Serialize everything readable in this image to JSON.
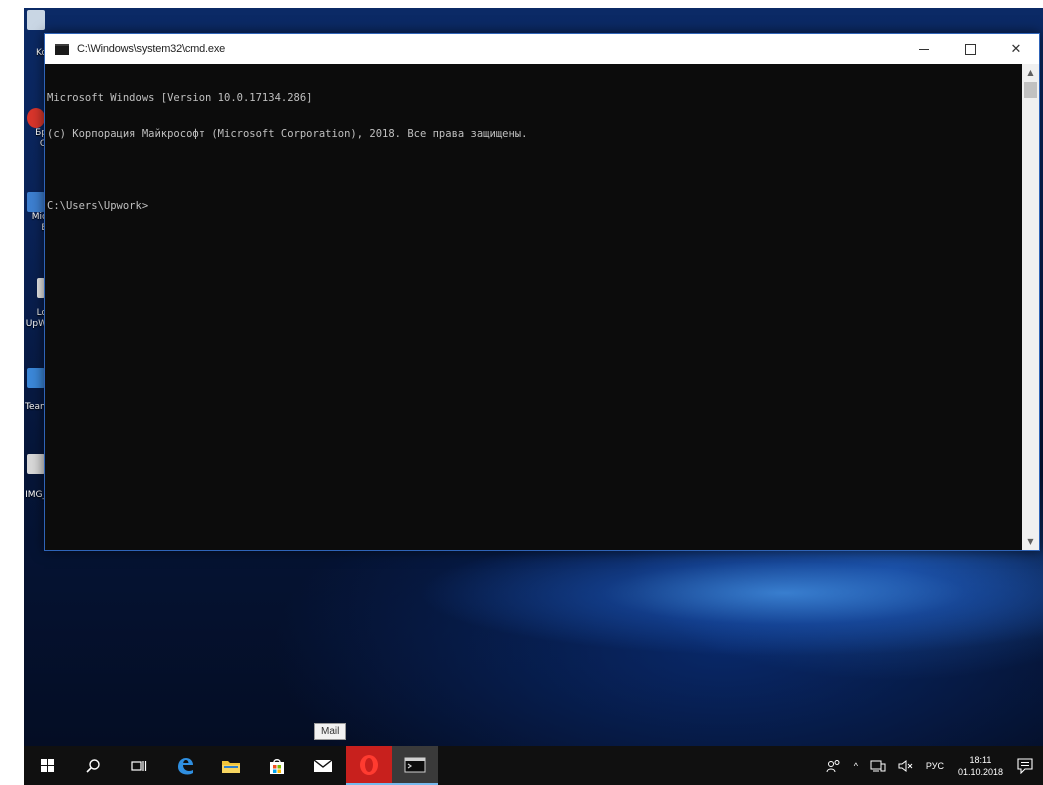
{
  "window": {
    "title": "C:\\Windows\\system32\\cmd.exe",
    "console_lines": [
      "Microsoft Windows [Version 10.0.17134.286]",
      "(c) Корпорация Майкрософт (Microsoft Corporation), 2018. Все права защищены.",
      "",
      "C:\\Users\\Upwork>"
    ]
  },
  "desktop_icons": [
    {
      "label": "Ko",
      "icon": "recycle-bin-icon",
      "color": "#c9d6e4"
    },
    {
      "label": "Бр",
      "label2": "O",
      "icon": "opera-icon",
      "color": "#d8352b"
    },
    {
      "label": "Mic",
      "label2": "E",
      "icon": "document-icon",
      "color": "#3d7fd0"
    },
    {
      "label": "Lo",
      "label2": "UpW",
      "icon": "shortcut-icon",
      "color": "#e8e8e8"
    },
    {
      "label": "Team",
      "icon": "teamviewer-icon",
      "color": "#3b87d8"
    },
    {
      "label": "IMG_",
      "icon": "image-file-icon",
      "color": "#d8d8d8"
    }
  ],
  "tooltip": "Mail",
  "taskbar": {
    "items": [
      {
        "name": "start-button",
        "icon": "windows-icon"
      },
      {
        "name": "search-button",
        "icon": "search-icon"
      },
      {
        "name": "task-view-button",
        "icon": "task-view-icon"
      },
      {
        "name": "edge-button",
        "icon": "edge-icon"
      },
      {
        "name": "file-explorer-button",
        "icon": "folder-icon"
      },
      {
        "name": "store-button",
        "icon": "store-icon"
      },
      {
        "name": "mail-button",
        "icon": "mail-icon"
      },
      {
        "name": "opera-button",
        "icon": "opera-icon"
      },
      {
        "name": "cmd-button",
        "icon": "cmd-icon"
      }
    ],
    "tray": {
      "people_icon": "people-icon",
      "chevron": "^",
      "language": "РУС",
      "time": "18:11",
      "date": "01.10.2018"
    }
  },
  "colors": {
    "console_bg": "#0c0c0c",
    "console_text": "#c0c0c0",
    "taskbar_bg": "#101010",
    "accent": "#76b9ed"
  }
}
